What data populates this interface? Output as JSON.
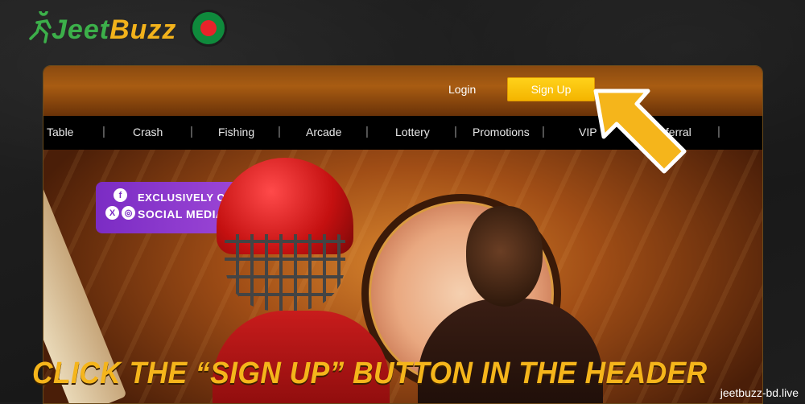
{
  "brand": {
    "logo_part1": "Jeet",
    "logo_part2": "Buzz"
  },
  "header": {
    "login_label": "Login",
    "signup_label": "Sign Up"
  },
  "nav": {
    "items": [
      "Table",
      "Crash",
      "Fishing",
      "Arcade",
      "Lottery",
      "Promotions",
      "VIP",
      "Referral"
    ]
  },
  "banner": {
    "social_line1": "EXCLUSIVELY ON",
    "social_line2": "SOCIAL MEDIA",
    "icons": [
      "facebook-icon",
      "x-icon",
      "instagram-icon"
    ]
  },
  "caption": "CLICK THE “SIGN UP” BUTTON IN THE HEADER",
  "watermark": "jeetbuzz-bd.live",
  "colors": {
    "accent": "#f5b51b",
    "signup_bg": "#f4b400",
    "logo_green": "#3cb04a",
    "flag_red": "#e8232a"
  }
}
